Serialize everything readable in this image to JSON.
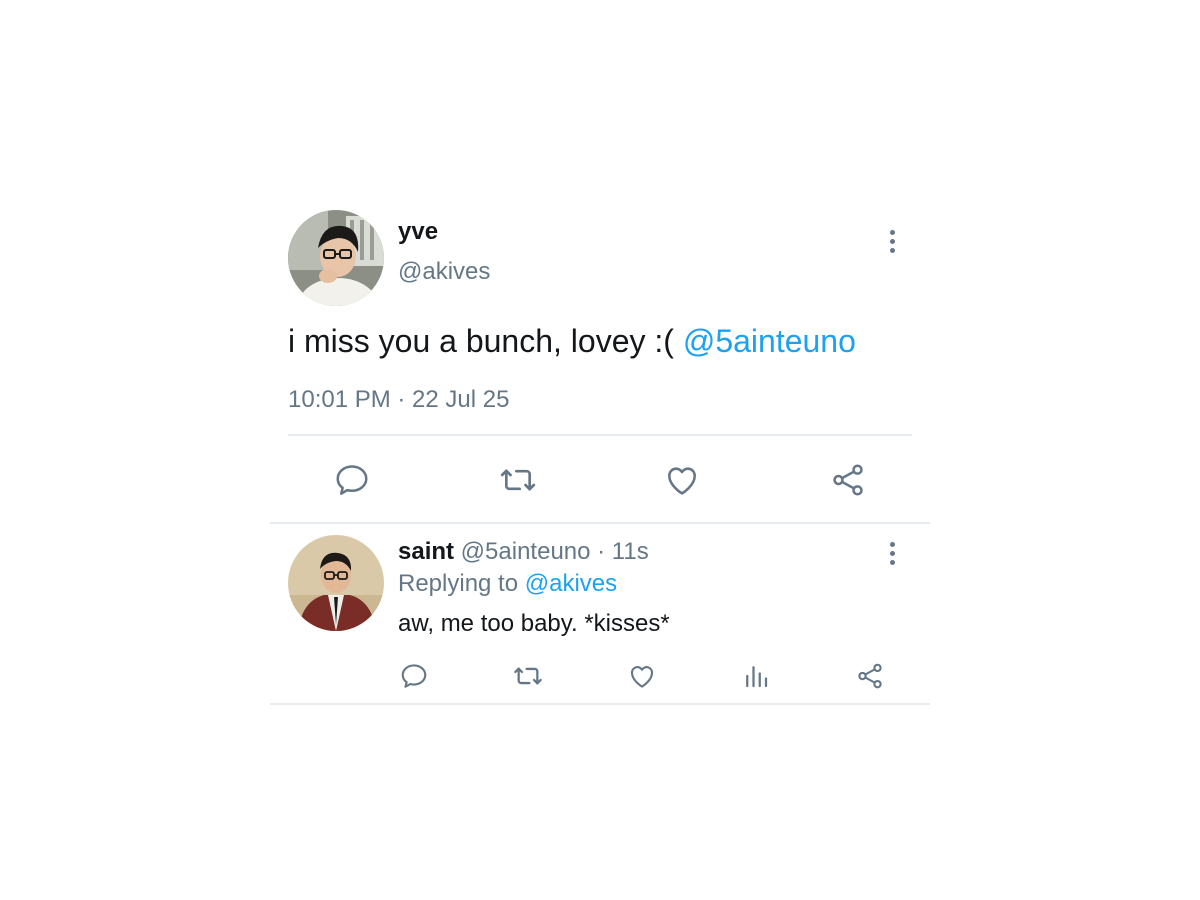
{
  "main_tweet": {
    "display_name": "yve",
    "handle": "@akives",
    "text": "i miss you a bunch, lovey :( ",
    "mention": "@5ainteuno",
    "timestamp": "10:01 PM · 22 Jul 25",
    "actions": [
      "reply-icon",
      "retweet-icon",
      "like-icon",
      "share-icon"
    ]
  },
  "reply_tweet": {
    "display_name": "saint",
    "handle_meta": " @5ainteuno · 11s",
    "replying_prefix": "Replying to ",
    "replying_to": "@akives",
    "text": "aw, me too baby. *kisses*",
    "actions": [
      "reply-icon",
      "retweet-icon",
      "like-icon",
      "analytics-icon",
      "share-icon"
    ]
  },
  "colors": {
    "text": "#14171a",
    "secondary": "#657786",
    "accent": "#1da1f2",
    "divider": "#e6ecf0"
  }
}
